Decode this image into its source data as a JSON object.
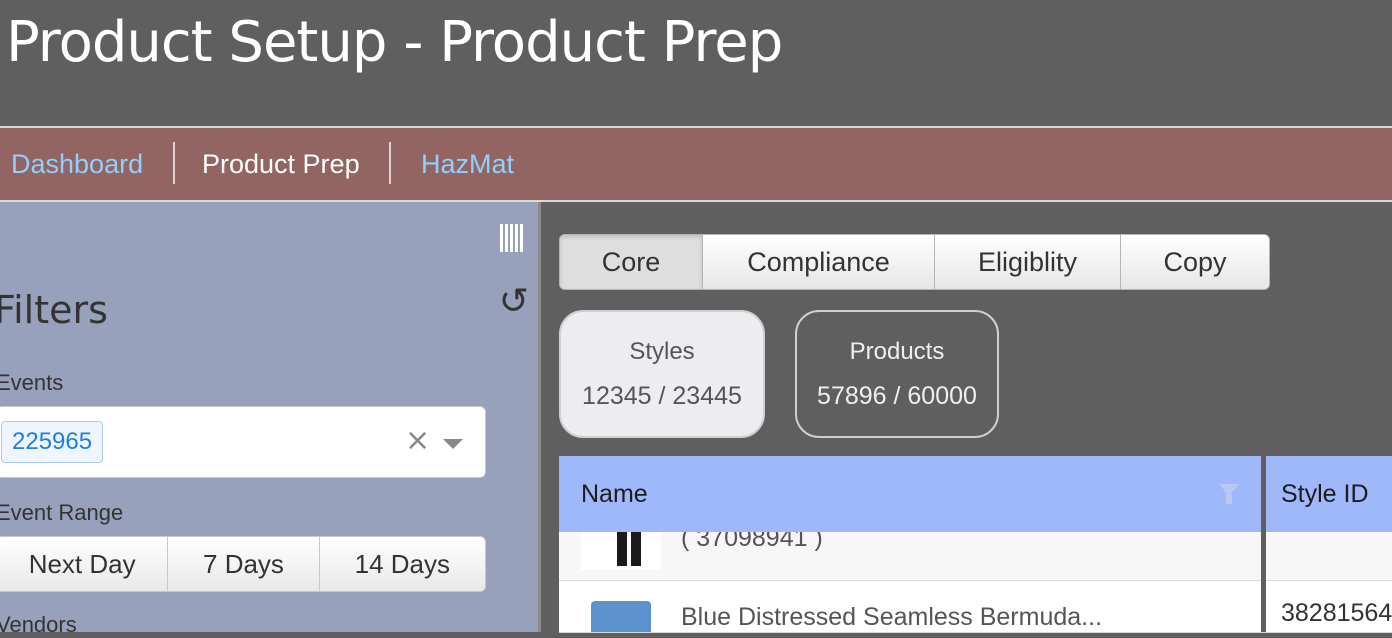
{
  "header": {
    "title": "Product Setup - Product Prep"
  },
  "nav": {
    "items": [
      {
        "label": "Dashboard",
        "color": "#8fd0ff"
      },
      {
        "label": "Product Prep",
        "color": "#ffffff"
      },
      {
        "label": "HazMat",
        "color": "#8fd0ff"
      }
    ]
  },
  "sidebar": {
    "heading": "Filters",
    "events_label": "Events",
    "events_selected": "225965",
    "range_label": "Event Range",
    "range_options": [
      "Next Day",
      "7 Days",
      "14 Days"
    ],
    "vendors_label": "Vendors",
    "icons": {
      "columns": "columns-icon",
      "reset": "reset-icon",
      "clear": "clear-icon",
      "dropdown": "chevron-down-icon"
    }
  },
  "tabs": [
    "Core",
    "Compliance",
    "Eligiblity",
    "Copy"
  ],
  "active_tab": "Core",
  "stats": {
    "styles": {
      "label": "Styles",
      "value": "12345 / 23445"
    },
    "products": {
      "label": "Products",
      "value": "57896 / 60000"
    }
  },
  "grid": {
    "columns": [
      "Name",
      "Style ID"
    ],
    "rows": [
      {
        "name": "( 37098941 )",
        "style_id": ""
      },
      {
        "name": "Blue Distressed Seamless Bermuda...",
        "style_id": "38281564"
      }
    ]
  },
  "colors": {
    "header_bg": "#5f5f5f",
    "nav_bg": "#926563",
    "sidebar_bg": "#97a1bc",
    "grid_header": "#9fb8fa"
  }
}
